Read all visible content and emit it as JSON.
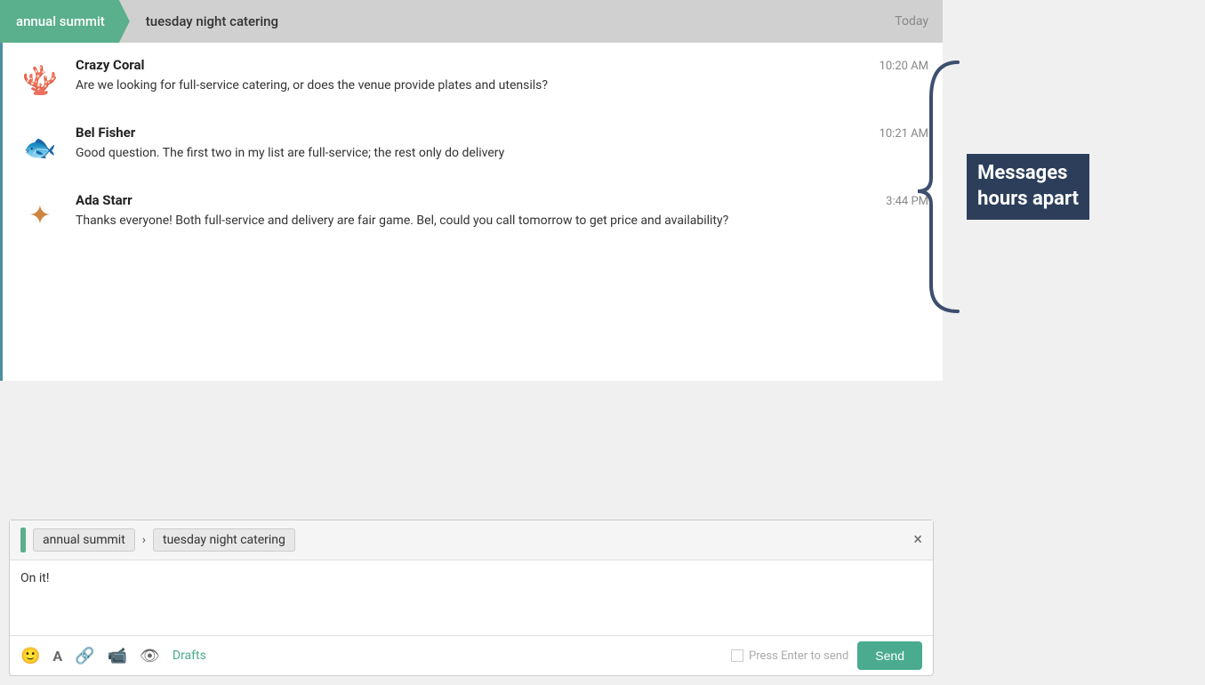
{
  "header": {
    "parent_channel": "annual summit",
    "child_channel": "tuesday night catering",
    "date": "Today"
  },
  "messages": [
    {
      "id": 1,
      "sender": "Crazy Coral",
      "time": "10:20 AM",
      "text": "Are we looking for full-service catering, or does the venue provide plates and utensils?",
      "avatar_emoji": "🪸",
      "avatar_type": "coral"
    },
    {
      "id": 2,
      "sender": "Bel Fisher",
      "time": "10:21 AM",
      "text": "Good question. The first two in my list are full-service; the rest only do delivery",
      "avatar_emoji": "🐟",
      "avatar_type": "fish"
    },
    {
      "id": 3,
      "sender": "Ada Starr",
      "time": "3:44 PM",
      "text": "Thanks everyone! Both full-service and delivery are fair game. Bel, could you call tomorrow to get price and availability?",
      "avatar_emoji": "⭐",
      "avatar_type": "starfish"
    }
  ],
  "annotation": {
    "label_line1": "Messages",
    "label_line2": "hours apart"
  },
  "compose": {
    "parent_label": "annual summit",
    "child_label": "tuesday night catering",
    "text": "On it!",
    "close_label": "×",
    "drafts_label": "Drafts",
    "press_enter_label": "Press Enter to send",
    "send_button_label": "Send"
  }
}
